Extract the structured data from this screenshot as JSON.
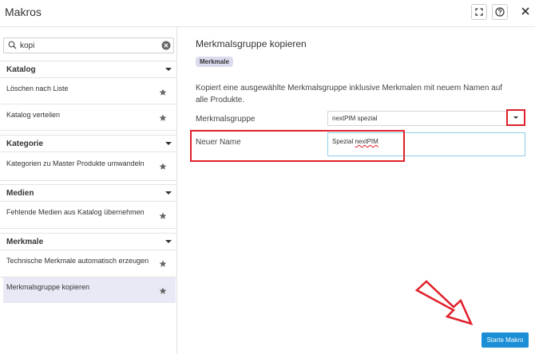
{
  "window": {
    "title": "Makros"
  },
  "search": {
    "value": "kopi"
  },
  "sidebar": {
    "groups": [
      {
        "label": "Katalog",
        "items": [
          "Löschen nach Liste",
          "Katalog verteilen"
        ]
      },
      {
        "label": "Kategorie",
        "items": [
          "Kategorien zu Master Produkte umwandeln"
        ]
      },
      {
        "label": "Medien",
        "items": [
          "Fehlende Medien aus Katalog übernehmen"
        ]
      },
      {
        "label": "Merkmale",
        "items": [
          "Technische Merkmale automatisch erzeugen",
          "Merkmalsgruppe kopieren"
        ]
      }
    ]
  },
  "main": {
    "title": "Merkmalsgruppe kopieren",
    "badge": "Merkmale",
    "description": "Kopiert eine ausgewählte Merkmalsgruppe inklusive Merkmalen mit neuem Namen auf alle Produkte.",
    "group_label": "Merkmalsgruppe",
    "group_value": "nextPIM spezial",
    "name_label": "Neuer Name",
    "name_value_a": "Spezial ",
    "name_value_b": "nextPIM",
    "run_label": "Starte Makro"
  },
  "colors": {
    "accent": "#1a8fd6",
    "annotation": "#e0202a",
    "selected": "#e9e9f6"
  }
}
